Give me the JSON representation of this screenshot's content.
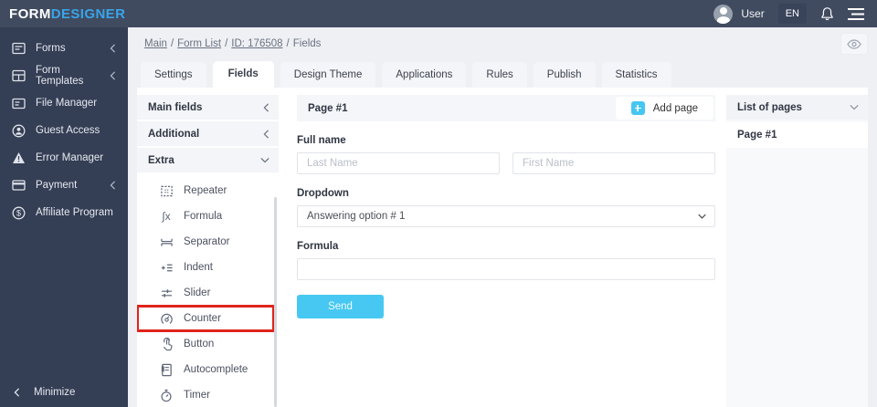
{
  "topbar": {
    "logo_part1": "FORM",
    "logo_part2": "DESIGNER",
    "user_label": "User",
    "language": "EN"
  },
  "sidebar": {
    "items": [
      {
        "label": "Forms",
        "icon": "forms-icon",
        "collapsible": true
      },
      {
        "label": "Form Templates",
        "icon": "form-templates-icon",
        "collapsible": true
      },
      {
        "label": "File Manager",
        "icon": "file-manager-icon",
        "collapsible": false
      },
      {
        "label": "Guest Access",
        "icon": "guest-access-icon",
        "collapsible": false
      },
      {
        "label": "Error Manager",
        "icon": "error-manager-icon",
        "collapsible": false
      },
      {
        "label": "Payment",
        "icon": "payment-icon",
        "collapsible": true
      },
      {
        "label": "Affiliate Program",
        "icon": "affiliate-program-icon",
        "collapsible": false
      }
    ],
    "minimize_label": "Minimize"
  },
  "breadcrumb": {
    "separator": "/",
    "links": [
      "Main",
      "Form List",
      "ID: 176508"
    ],
    "current": "Fields"
  },
  "tabs": [
    {
      "label": "Settings",
      "active": false
    },
    {
      "label": "Fields",
      "active": true
    },
    {
      "label": "Design Theme",
      "active": false
    },
    {
      "label": "Applications",
      "active": false
    },
    {
      "label": "Rules",
      "active": false
    },
    {
      "label": "Publish",
      "active": false
    },
    {
      "label": "Statistics",
      "active": false
    }
  ],
  "fields_panel": {
    "sections": [
      {
        "label": "Main fields",
        "state": "collapsed"
      },
      {
        "label": "Additional",
        "state": "collapsed"
      },
      {
        "label": "Extra",
        "state": "expanded"
      }
    ],
    "extra_items": [
      {
        "label": "Repeater",
        "icon": "repeater-icon",
        "highlighted": false
      },
      {
        "label": "Formula",
        "icon": "formula-icon",
        "highlighted": false
      },
      {
        "label": "Separator",
        "icon": "separator-icon",
        "highlighted": false
      },
      {
        "label": "Indent",
        "icon": "indent-icon",
        "highlighted": false
      },
      {
        "label": "Slider",
        "icon": "slider-icon",
        "highlighted": false
      },
      {
        "label": "Counter",
        "icon": "counter-icon",
        "highlighted": true
      },
      {
        "label": "Button",
        "icon": "button-icon",
        "highlighted": false
      },
      {
        "label": "Autocomplete",
        "icon": "autocomplete-icon",
        "highlighted": false
      },
      {
        "label": "Timer",
        "icon": "timer-icon",
        "highlighted": false
      }
    ]
  },
  "page_editor": {
    "page_title": "Page #1",
    "add_page_label": "Add page",
    "full_name_label": "Full name",
    "last_name_placeholder": "Last Name",
    "first_name_placeholder": "First Name",
    "dropdown_label": "Dropdown",
    "dropdown_selected": "Answering option # 1",
    "formula_label": "Formula",
    "formula_value": "",
    "send_label": "Send"
  },
  "pages_panel": {
    "title": "List of pages",
    "pages": [
      {
        "label": "Page #1"
      }
    ]
  },
  "colors": {
    "topbar_dark": "#414b5f",
    "sidebar_dark": "#343e54",
    "accent_blue": "#47c8f2",
    "logo_blue": "#38a5ea",
    "highlight_red": "#e0241c",
    "page_background": "#eef0f4"
  }
}
